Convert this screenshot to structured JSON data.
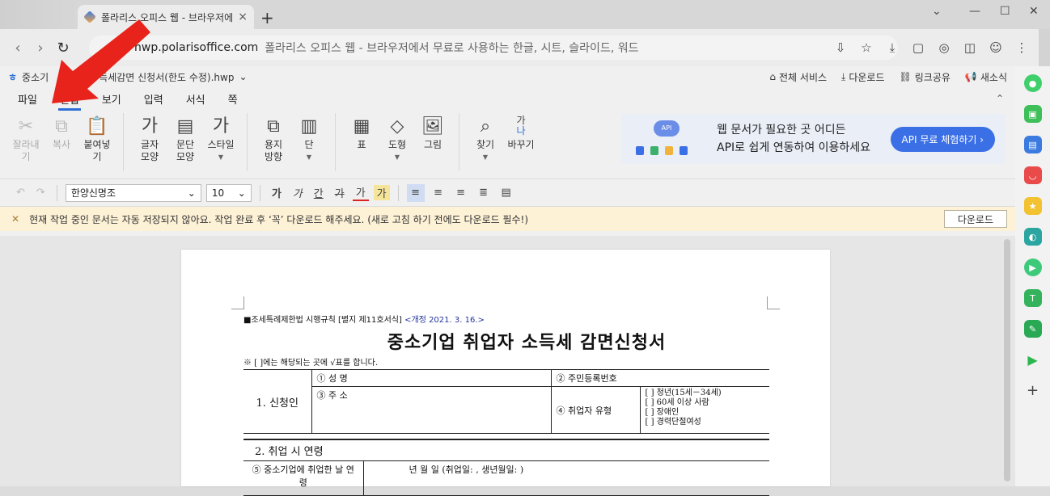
{
  "browser": {
    "tab_title": "폴라리스 오피스 웹 - 브라우저에",
    "new_tab": "+",
    "url_host": "hwp.polarisoffice.com",
    "url_desc": "폴라리스 오피스 웹 - 브라우저에서 무료로 사용하는 한글, 시트, 슬라이드, 워드"
  },
  "app": {
    "doc_prefix": "중소기",
    "doc_name": "득세감면 신청서(한도 수정).hwp",
    "top_links": [
      "전체 서비스",
      "다운로드",
      "링크공유",
      "새소식"
    ],
    "menu_tabs": [
      "파일",
      "편집",
      "보기",
      "입력",
      "서식",
      "쪽"
    ],
    "active_tab": "편집"
  },
  "ribbon": {
    "cut": "잘라내기",
    "copy": "복사",
    "paste": "붙여넣기",
    "char_shape": [
      "글자",
      "모양"
    ],
    "para_shape": [
      "문단",
      "모양"
    ],
    "style": "스타일",
    "page_dir": [
      "용지",
      "방향"
    ],
    "column": "단",
    "table": "표",
    "shape": "도형",
    "picture": "그림",
    "find": "찾기",
    "replace": "바꾸기",
    "glyph_ga": "가",
    "glyph_ga_na": "가",
    "glyph_na": "나"
  },
  "banner": {
    "line1": "웹 문서가 필요한 곳 어디든",
    "line2": "API로 쉽게 연동하여 이용하세요",
    "cta": "API 무료 체험하기 ›",
    "badge": "API"
  },
  "format_bar": {
    "font": "한양신명조",
    "size": "10",
    "styles": [
      "가",
      "가",
      "간",
      "가",
      "가",
      "가"
    ]
  },
  "notice": {
    "text": "현재 작업 중인 문서는 자동 저장되지 않아요. 작업 완료 후 ‘꼭’ 다운로드 해주세요. (새로 고침 하기 전에도 다운로드 필수!)",
    "button": "다운로드"
  },
  "document": {
    "law_line": "■조세특례제한법 시행규칙 [별지 제11호서식]",
    "revision": "<개정 2021. 3. 16.>",
    "title": "중소기업 취업자 소득세 감면신청서",
    "note": "※ [  ]에는 해당되는 곳에 √표를 합니다.",
    "applicant": "1. 신청인",
    "name_label": "① 성 명",
    "rrn_label": "② 주민등록번호",
    "address_label": "③ 주 소",
    "type_label": "④ 취업자 유형",
    "type_options": [
      "[ ] 청년(15세－34세)",
      "[ ] 60세 이상 사람",
      "[ ] 장애인",
      "[ ] 경력단절여성"
    ],
    "section2": "2. 취업 시 연령",
    "row5_label": "⑤ 중소기업에 취업한 날 연령",
    "row5_value": "년     월     일  (취업일:                   ,  생년월일:                    )"
  },
  "colors": {
    "accent": "#2d6fd6",
    "notice_bg": "#fdf1d6",
    "cta": "#3b6fe6",
    "arrow": "#e8231b"
  }
}
